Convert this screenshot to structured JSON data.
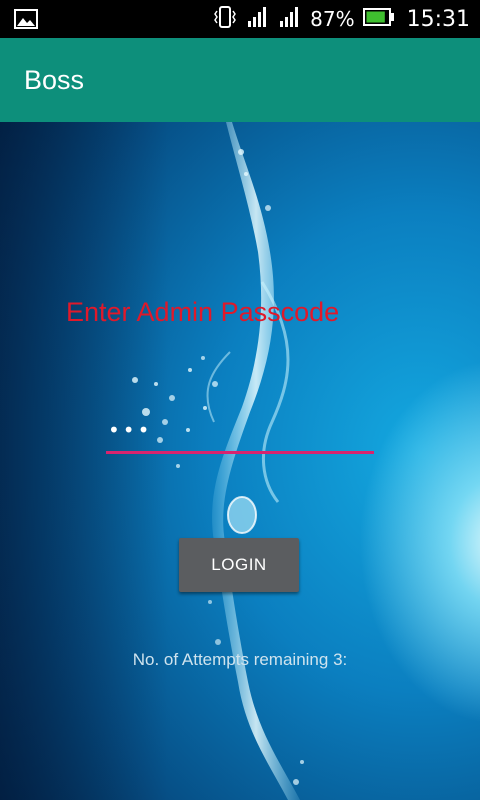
{
  "status_bar": {
    "left_icon": "image-icon",
    "icons": [
      "vibrate-icon",
      "signal-icon",
      "signal-icon"
    ],
    "battery_percent": "87%",
    "battery_level": 0.87,
    "time": "15:31"
  },
  "app_bar": {
    "title": "Boss",
    "color": "#0d8f7b"
  },
  "login_form": {
    "prompt": "Enter Admin Passcode",
    "passcode_value": "•••",
    "button_label": "LOGIN",
    "attempts_text": "No. of Attempts remaining 3:",
    "prompt_color": "#e0192a",
    "underline_color": "#d8246e"
  },
  "background": {
    "image": "water-splash"
  }
}
